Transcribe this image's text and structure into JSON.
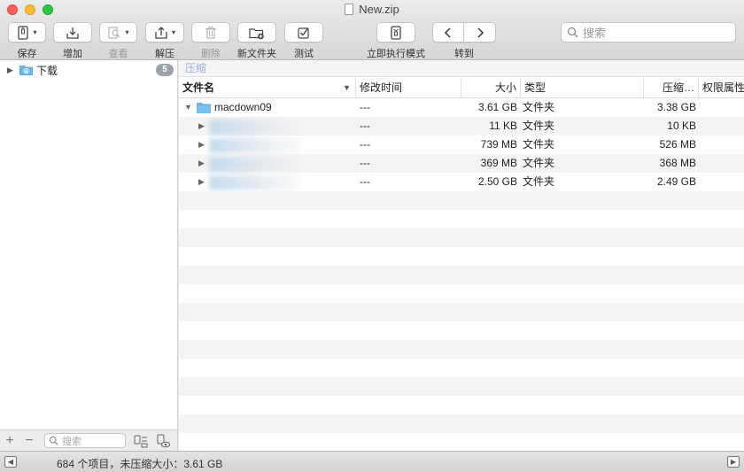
{
  "window": {
    "title": "New.zip"
  },
  "toolbar": {
    "save": "保存",
    "add": "增加",
    "view": "查看",
    "extract": "解压",
    "delete": "删除",
    "new_folder": "新文件夹",
    "test": "测试",
    "execute": "立即执行模式",
    "goto": "转到",
    "search_placeholder": "搜索"
  },
  "sidebar": {
    "items": [
      {
        "label": "下载",
        "badge": "5"
      }
    ],
    "search_placeholder": "搜索"
  },
  "main": {
    "path": "压缩",
    "columns": [
      "文件名",
      "修改时间",
      "大小",
      "类型",
      "压缩…",
      "权限属性"
    ],
    "rows": [
      {
        "name": "macdown09",
        "modified": "---",
        "size": "3.61 GB",
        "type": "文件夹",
        "compressed": "3.38 GB"
      },
      {
        "name": "",
        "modified": "---",
        "size": "11 KB",
        "type": "文件夹",
        "compressed": "10 KB"
      },
      {
        "name": "",
        "modified": "---",
        "size": "739 MB",
        "type": "文件夹",
        "compressed": "526 MB"
      },
      {
        "name": "",
        "modified": "---",
        "size": "369 MB",
        "type": "文件夹",
        "compressed": "368 MB"
      },
      {
        "name": "",
        "modified": "---",
        "size": "2.50 GB",
        "type": "文件夹",
        "compressed": "2.49 GB"
      }
    ]
  },
  "status": {
    "text": "684 个项目，未压缩大小：3.61 GB"
  },
  "colors": {
    "folder": "#6cb6ee",
    "badge": "#9aa2ad",
    "path_text": "#9db1d3"
  }
}
